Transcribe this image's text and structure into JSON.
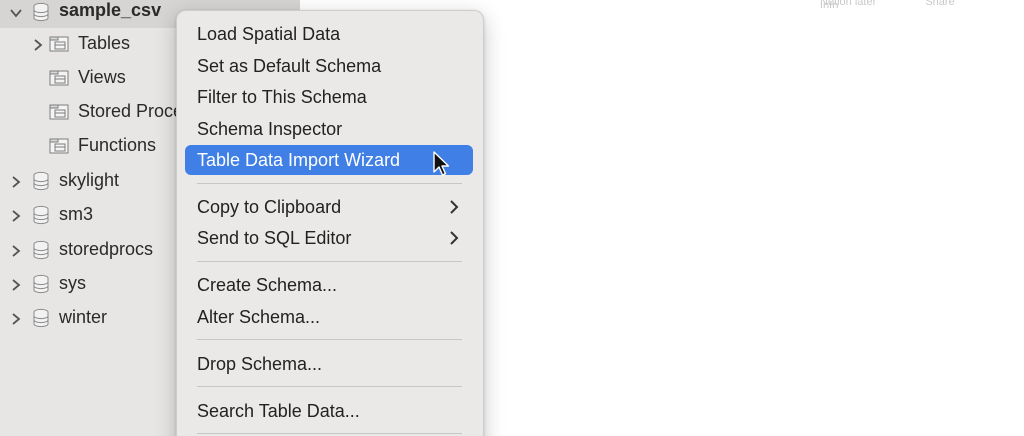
{
  "top_header": {
    "items": [
      "Notion later",
      "Share",
      "Info"
    ]
  },
  "sidebar": {
    "schemas": [
      {
        "name": "sample_csv",
        "expanded": true,
        "selected": true
      },
      {
        "name": "skylight",
        "expanded": false
      },
      {
        "name": "sm3",
        "expanded": false
      },
      {
        "name": "storedprocs",
        "expanded": false
      },
      {
        "name": "sys",
        "expanded": false
      },
      {
        "name": "winter",
        "expanded": false
      }
    ],
    "children": [
      {
        "label": "Tables",
        "has_chevron": true
      },
      {
        "label": "Views",
        "has_chevron": false
      },
      {
        "label": "Stored Procedures",
        "has_chevron": false
      },
      {
        "label": "Functions",
        "has_chevron": false
      }
    ]
  },
  "context_menu": {
    "items": [
      {
        "label": "Load Spatial Data"
      },
      {
        "label": "Set as Default Schema"
      },
      {
        "label": "Filter to This Schema"
      },
      {
        "label": "Schema Inspector"
      },
      {
        "label": "Table Data Import Wizard",
        "highlighted": true
      },
      {
        "label": "Copy to Clipboard",
        "submenu": true
      },
      {
        "label": "Send to SQL Editor",
        "submenu": true
      },
      {
        "label": "Create Schema..."
      },
      {
        "label": "Alter Schema..."
      },
      {
        "label": "Drop Schema..."
      },
      {
        "label": "Search Table Data..."
      }
    ]
  },
  "colors": {
    "highlight": "#3f7fe6",
    "sidebar_bg": "#e8e6e4",
    "menu_bg": "#ebe9e8"
  },
  "icons": {
    "schema": "database-icon",
    "folder": "folder-icon",
    "expand": "chevron-right-icon",
    "collapse": "chevron-down-icon",
    "submenu": "chevron-right-icon",
    "pointer": "mouse-cursor-icon"
  }
}
